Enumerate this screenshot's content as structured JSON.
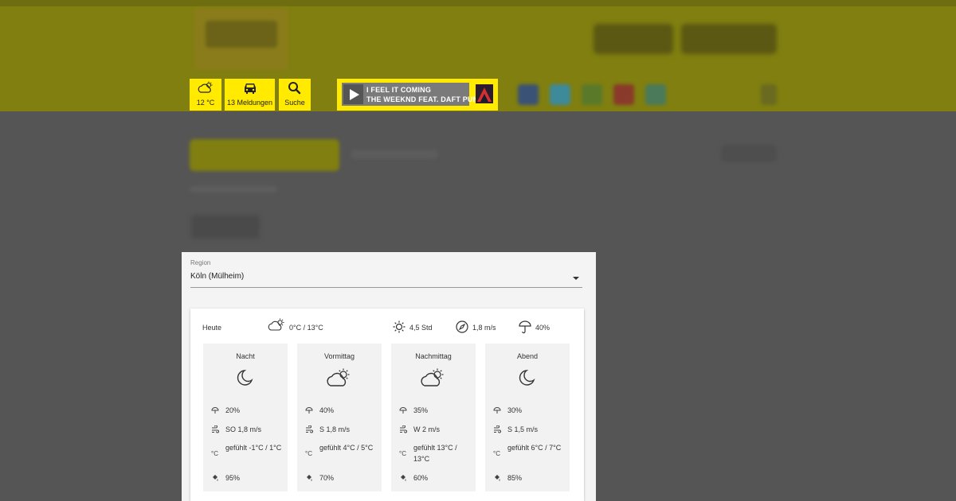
{
  "header": {
    "weather_tile": {
      "label": "12 °C",
      "icon": "partly-cloudy-icon"
    },
    "traffic_tile": {
      "label": "13 Meldungen",
      "icon": "car-icon"
    },
    "search_tile": {
      "label": "Suche",
      "icon": "search-icon"
    },
    "player": {
      "song_title": "I FEEL IT COMING",
      "artist": "THE WEEKND FEAT. DAFT PUNK",
      "icon": "play-icon"
    }
  },
  "weather": {
    "region": {
      "label": "Region",
      "value": "Köln (Mülheim)"
    },
    "summary": {
      "day": "Heute",
      "temp_range": "0°C / 13°C",
      "sunshine": "4,5 Std",
      "wind": "1,8 m/s",
      "precip": "40%"
    },
    "periods": [
      {
        "name": "Nacht",
        "icon": "moon-icon",
        "rain": "20%",
        "wind": "SO 1,8 m/s",
        "feels": "gefühlt -1°C / 1°C",
        "humidity": "95%"
      },
      {
        "name": "Vormittag",
        "icon": "sun-cloud-icon",
        "rain": "40%",
        "wind": "S 1,8 m/s",
        "feels": "gefühlt 4°C / 5°C",
        "humidity": "70%"
      },
      {
        "name": "Nachmittag",
        "icon": "sun-cloud-icon",
        "rain": "35%",
        "wind": "W 2 m/s",
        "feels": "gefühlt 13°C / 13°C",
        "humidity": "60%"
      },
      {
        "name": "Abend",
        "icon": "moon-icon",
        "rain": "30%",
        "wind": "S 1,5 m/s",
        "feels": "gefühlt 6°C / 7°C",
        "humidity": "85%"
      }
    ]
  },
  "colors": {
    "accent": "#ffea00",
    "overlay": "#555555"
  }
}
